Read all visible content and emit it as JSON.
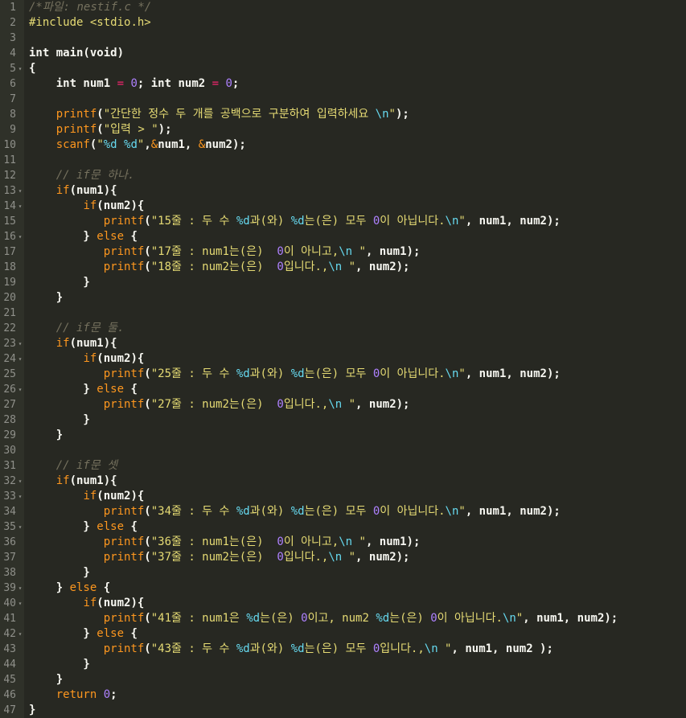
{
  "editor": {
    "language": "c",
    "lines": [
      {
        "n": "1",
        "fold": false,
        "tokens": [
          [
            "x",
            "/*파일: nestif.c */"
          ]
        ]
      },
      {
        "n": "2",
        "fold": false,
        "tokens": [
          [
            "c",
            "#include"
          ],
          [
            "t",
            " "
          ],
          [
            "c",
            "<stdio.h>"
          ]
        ]
      },
      {
        "n": "3",
        "fold": false,
        "tokens": []
      },
      {
        "n": "4",
        "fold": false,
        "tokens": [
          [
            "t",
            "int main(void)"
          ]
        ]
      },
      {
        "n": "5",
        "fold": true,
        "tokens": [
          [
            "t",
            "{"
          ]
        ]
      },
      {
        "n": "6",
        "fold": false,
        "tokens": [
          [
            "t",
            "    int num1 "
          ],
          [
            "k",
            "="
          ],
          [
            "t",
            " "
          ],
          [
            "n",
            "0"
          ],
          [
            "t",
            "; int num2 "
          ],
          [
            "k",
            "="
          ],
          [
            "t",
            " "
          ],
          [
            "n",
            "0"
          ],
          [
            "t",
            ";"
          ]
        ]
      },
      {
        "n": "7",
        "fold": false,
        "tokens": []
      },
      {
        "n": "8",
        "fold": false,
        "tokens": [
          [
            "t",
            "    "
          ],
          [
            "f",
            "printf"
          ],
          [
            "t",
            "("
          ],
          [
            "s",
            "\"간단한 정수 두 개를 공백으로 구분하여 입력하세요 "
          ],
          [
            "e",
            "\\n"
          ],
          [
            "s",
            "\""
          ],
          [
            "t",
            ");"
          ]
        ]
      },
      {
        "n": "9",
        "fold": false,
        "tokens": [
          [
            "t",
            "    "
          ],
          [
            "f",
            "printf"
          ],
          [
            "t",
            "("
          ],
          [
            "s",
            "\"입력 > \""
          ],
          [
            "t",
            ");"
          ]
        ]
      },
      {
        "n": "10",
        "fold": false,
        "tokens": [
          [
            "t",
            "    "
          ],
          [
            "f",
            "scanf"
          ],
          [
            "t",
            "("
          ],
          [
            "s",
            "\""
          ],
          [
            "e",
            "%d"
          ],
          [
            "s",
            " "
          ],
          [
            "e",
            "%d"
          ],
          [
            "s",
            "\""
          ],
          [
            "t",
            ","
          ],
          [
            "f",
            "&"
          ],
          [
            "t",
            "num1, "
          ],
          [
            "f",
            "&"
          ],
          [
            "t",
            "num2);"
          ]
        ]
      },
      {
        "n": "11",
        "fold": false,
        "tokens": []
      },
      {
        "n": "12",
        "fold": false,
        "tokens": [
          [
            "t",
            "    "
          ],
          [
            "x",
            "// if문 하나."
          ]
        ]
      },
      {
        "n": "13",
        "fold": true,
        "tokens": [
          [
            "t",
            "    "
          ],
          [
            "f",
            "if"
          ],
          [
            "t",
            "(num1){"
          ]
        ]
      },
      {
        "n": "14",
        "fold": true,
        "tokens": [
          [
            "t",
            "        "
          ],
          [
            "f",
            "if"
          ],
          [
            "t",
            "(num2){"
          ]
        ]
      },
      {
        "n": "15",
        "fold": false,
        "tokens": [
          [
            "t",
            "           "
          ],
          [
            "f",
            "printf"
          ],
          [
            "t",
            "("
          ],
          [
            "s",
            "\"15줄 : 두 수 "
          ],
          [
            "e",
            "%d"
          ],
          [
            "s",
            "과(와) "
          ],
          [
            "e",
            "%d"
          ],
          [
            "s",
            "는(은) 모두 "
          ],
          [
            "n",
            "0"
          ],
          [
            "s",
            "이 아닙니다."
          ],
          [
            "e",
            "\\n"
          ],
          [
            "s",
            "\""
          ],
          [
            "t",
            ", num1, num2);"
          ]
        ]
      },
      {
        "n": "16",
        "fold": true,
        "tokens": [
          [
            "t",
            "        } "
          ],
          [
            "f",
            "else"
          ],
          [
            "t",
            " {"
          ]
        ]
      },
      {
        "n": "17",
        "fold": false,
        "tokens": [
          [
            "t",
            "           "
          ],
          [
            "f",
            "printf"
          ],
          [
            "t",
            "("
          ],
          [
            "s",
            "\"17줄 : num1는(은)  "
          ],
          [
            "n",
            "0"
          ],
          [
            "s",
            "이 아니고,"
          ],
          [
            "e",
            "\\n"
          ],
          [
            "s",
            " \""
          ],
          [
            "t",
            ", num1);"
          ]
        ]
      },
      {
        "n": "18",
        "fold": false,
        "tokens": [
          [
            "t",
            "           "
          ],
          [
            "f",
            "printf"
          ],
          [
            "t",
            "("
          ],
          [
            "s",
            "\"18줄 : num2는(은)  "
          ],
          [
            "n",
            "0"
          ],
          [
            "s",
            "입니다.,"
          ],
          [
            "e",
            "\\n"
          ],
          [
            "s",
            " \""
          ],
          [
            "t",
            ", num2);"
          ]
        ]
      },
      {
        "n": "19",
        "fold": false,
        "tokens": [
          [
            "t",
            "        }"
          ]
        ]
      },
      {
        "n": "20",
        "fold": false,
        "tokens": [
          [
            "t",
            "    }"
          ]
        ]
      },
      {
        "n": "21",
        "fold": false,
        "tokens": []
      },
      {
        "n": "22",
        "fold": false,
        "tokens": [
          [
            "t",
            "    "
          ],
          [
            "x",
            "// if문 둘."
          ]
        ]
      },
      {
        "n": "23",
        "fold": true,
        "tokens": [
          [
            "t",
            "    "
          ],
          [
            "f",
            "if"
          ],
          [
            "t",
            "(num1){"
          ]
        ]
      },
      {
        "n": "24",
        "fold": true,
        "tokens": [
          [
            "t",
            "        "
          ],
          [
            "f",
            "if"
          ],
          [
            "t",
            "(num2){"
          ]
        ]
      },
      {
        "n": "25",
        "fold": false,
        "tokens": [
          [
            "t",
            "           "
          ],
          [
            "f",
            "printf"
          ],
          [
            "t",
            "("
          ],
          [
            "s",
            "\"25줄 : 두 수 "
          ],
          [
            "e",
            "%d"
          ],
          [
            "s",
            "과(와) "
          ],
          [
            "e",
            "%d"
          ],
          [
            "s",
            "는(은) 모두 "
          ],
          [
            "n",
            "0"
          ],
          [
            "s",
            "이 아닙니다."
          ],
          [
            "e",
            "\\n"
          ],
          [
            "s",
            "\""
          ],
          [
            "t",
            ", num1, num2);"
          ]
        ]
      },
      {
        "n": "26",
        "fold": true,
        "tokens": [
          [
            "t",
            "        } "
          ],
          [
            "f",
            "else"
          ],
          [
            "t",
            " {"
          ]
        ]
      },
      {
        "n": "27",
        "fold": false,
        "tokens": [
          [
            "t",
            "           "
          ],
          [
            "f",
            "printf"
          ],
          [
            "t",
            "("
          ],
          [
            "s",
            "\"27줄 : num2는(은)  "
          ],
          [
            "n",
            "0"
          ],
          [
            "s",
            "입니다.,"
          ],
          [
            "e",
            "\\n"
          ],
          [
            "s",
            " \""
          ],
          [
            "t",
            ", num2);"
          ]
        ]
      },
      {
        "n": "28",
        "fold": false,
        "tokens": [
          [
            "t",
            "        }"
          ]
        ]
      },
      {
        "n": "29",
        "fold": false,
        "tokens": [
          [
            "t",
            "    }"
          ]
        ]
      },
      {
        "n": "30",
        "fold": false,
        "tokens": []
      },
      {
        "n": "31",
        "fold": false,
        "tokens": [
          [
            "t",
            "    "
          ],
          [
            "x",
            "// if문 셋"
          ]
        ]
      },
      {
        "n": "32",
        "fold": true,
        "tokens": [
          [
            "t",
            "    "
          ],
          [
            "f",
            "if"
          ],
          [
            "t",
            "(num1){"
          ]
        ]
      },
      {
        "n": "33",
        "fold": true,
        "tokens": [
          [
            "t",
            "        "
          ],
          [
            "f",
            "if"
          ],
          [
            "t",
            "(num2){"
          ]
        ]
      },
      {
        "n": "34",
        "fold": false,
        "tokens": [
          [
            "t",
            "           "
          ],
          [
            "f",
            "printf"
          ],
          [
            "t",
            "("
          ],
          [
            "s",
            "\"34줄 : 두 수 "
          ],
          [
            "e",
            "%d"
          ],
          [
            "s",
            "과(와) "
          ],
          [
            "e",
            "%d"
          ],
          [
            "s",
            "는(은) 모두 "
          ],
          [
            "n",
            "0"
          ],
          [
            "s",
            "이 아닙니다."
          ],
          [
            "e",
            "\\n"
          ],
          [
            "s",
            "\""
          ],
          [
            "t",
            ", num1, num2);"
          ]
        ]
      },
      {
        "n": "35",
        "fold": true,
        "tokens": [
          [
            "t",
            "        } "
          ],
          [
            "f",
            "else"
          ],
          [
            "t",
            " {"
          ]
        ]
      },
      {
        "n": "36",
        "fold": false,
        "tokens": [
          [
            "t",
            "           "
          ],
          [
            "f",
            "printf"
          ],
          [
            "t",
            "("
          ],
          [
            "s",
            "\"36줄 : num1는(은)  "
          ],
          [
            "n",
            "0"
          ],
          [
            "s",
            "이 아니고,"
          ],
          [
            "e",
            "\\n"
          ],
          [
            "s",
            " \""
          ],
          [
            "t",
            ", num1);"
          ]
        ]
      },
      {
        "n": "37",
        "fold": false,
        "tokens": [
          [
            "t",
            "           "
          ],
          [
            "f",
            "printf"
          ],
          [
            "t",
            "("
          ],
          [
            "s",
            "\"37줄 : num2는(은)  "
          ],
          [
            "n",
            "0"
          ],
          [
            "s",
            "입니다.,"
          ],
          [
            "e",
            "\\n"
          ],
          [
            "s",
            " \""
          ],
          [
            "t",
            ", num2);"
          ]
        ]
      },
      {
        "n": "38",
        "fold": false,
        "tokens": [
          [
            "t",
            "        }"
          ]
        ]
      },
      {
        "n": "39",
        "fold": true,
        "tokens": [
          [
            "t",
            "    } "
          ],
          [
            "f",
            "else"
          ],
          [
            "t",
            " {"
          ]
        ]
      },
      {
        "n": "40",
        "fold": true,
        "tokens": [
          [
            "t",
            "        "
          ],
          [
            "f",
            "if"
          ],
          [
            "t",
            "(num2){"
          ]
        ]
      },
      {
        "n": "41",
        "fold": false,
        "tokens": [
          [
            "t",
            "           "
          ],
          [
            "f",
            "printf"
          ],
          [
            "t",
            "("
          ],
          [
            "s",
            "\"41줄 : num1은 "
          ],
          [
            "e",
            "%d"
          ],
          [
            "s",
            "는(은) "
          ],
          [
            "n",
            "0"
          ],
          [
            "s",
            "이고, num2 "
          ],
          [
            "e",
            "%d"
          ],
          [
            "s",
            "는(은) "
          ],
          [
            "n",
            "0"
          ],
          [
            "s",
            "이 아닙니다."
          ],
          [
            "e",
            "\\n"
          ],
          [
            "s",
            "\""
          ],
          [
            "t",
            ", num1, num2);"
          ]
        ]
      },
      {
        "n": "42",
        "fold": true,
        "tokens": [
          [
            "t",
            "        } "
          ],
          [
            "f",
            "else"
          ],
          [
            "t",
            " {"
          ]
        ]
      },
      {
        "n": "43",
        "fold": false,
        "tokens": [
          [
            "t",
            "           "
          ],
          [
            "f",
            "printf"
          ],
          [
            "t",
            "("
          ],
          [
            "s",
            "\"43줄 : 두 수 "
          ],
          [
            "e",
            "%d"
          ],
          [
            "s",
            "과(와) "
          ],
          [
            "e",
            "%d"
          ],
          [
            "s",
            "는(은) 모두 "
          ],
          [
            "n",
            "0"
          ],
          [
            "s",
            "입니다.,"
          ],
          [
            "e",
            "\\n"
          ],
          [
            "s",
            " \""
          ],
          [
            "t",
            ", num1, num2 );"
          ]
        ]
      },
      {
        "n": "44",
        "fold": false,
        "tokens": [
          [
            "t",
            "        }"
          ]
        ]
      },
      {
        "n": "45",
        "fold": false,
        "tokens": [
          [
            "t",
            "    }"
          ]
        ]
      },
      {
        "n": "46",
        "fold": false,
        "tokens": [
          [
            "t",
            "    "
          ],
          [
            "f",
            "return"
          ],
          [
            "t",
            " "
          ],
          [
            "n",
            "0"
          ],
          [
            "t",
            ";"
          ]
        ]
      },
      {
        "n": "47",
        "fold": false,
        "tokens": [
          [
            "t",
            "}"
          ]
        ]
      }
    ]
  }
}
